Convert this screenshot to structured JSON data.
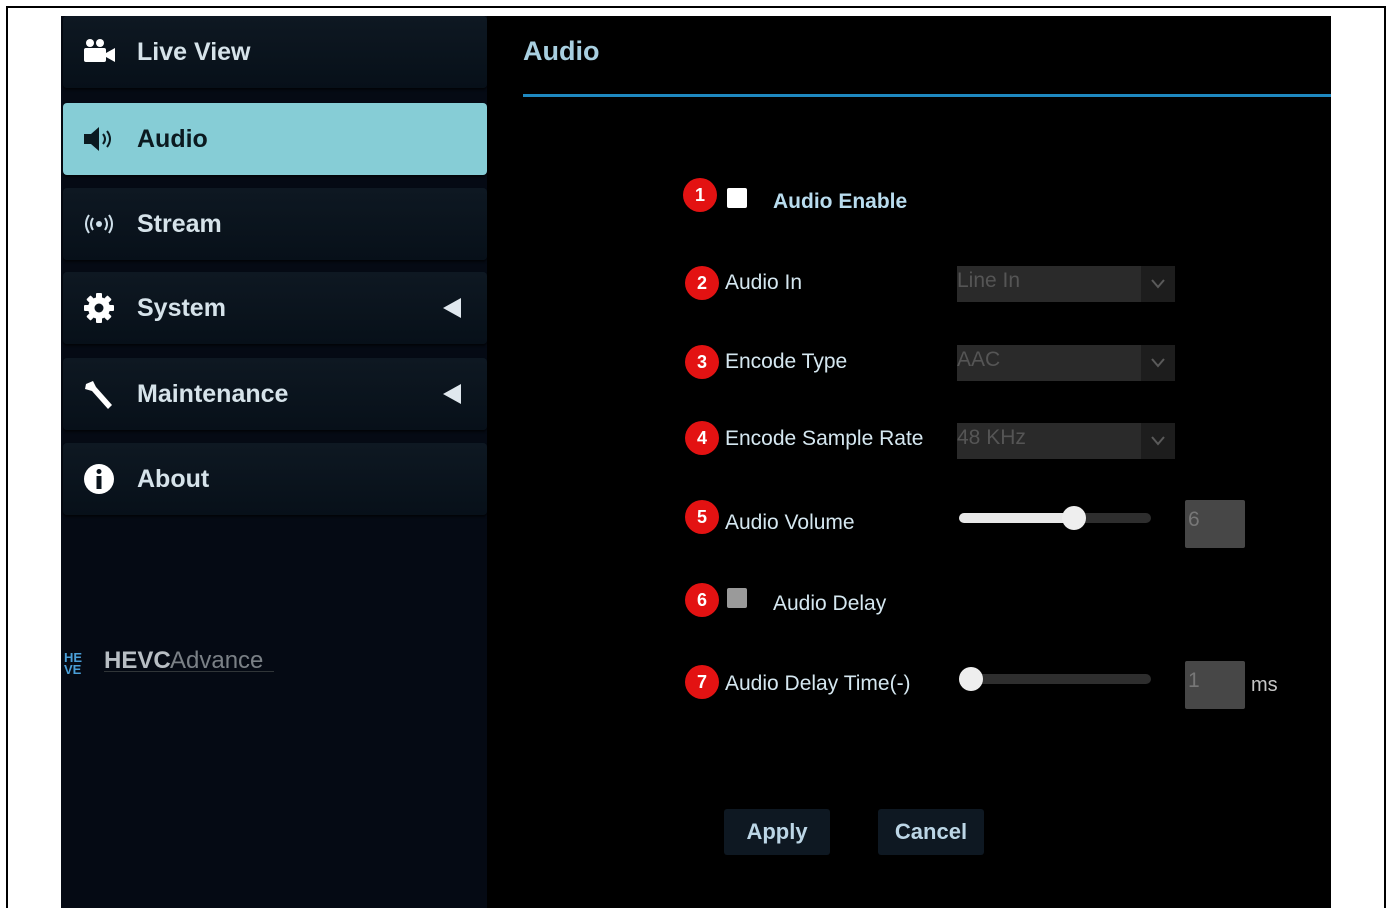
{
  "sidebar": {
    "items": [
      {
        "label": "Live View",
        "icon": "video-camera-icon"
      },
      {
        "label": "Audio",
        "icon": "speaker-icon",
        "active": true
      },
      {
        "label": "Stream",
        "icon": "broadcast-icon"
      },
      {
        "label": "System",
        "icon": "gear-icon"
      },
      {
        "label": "Maintenance",
        "icon": "wrench-icon"
      },
      {
        "label": "About",
        "icon": "info-icon"
      }
    ],
    "logo_text": "HEVCAdvance",
    "logo_mark": "HE VE"
  },
  "main": {
    "title": "Audio",
    "audio_enable": {
      "badge": "1",
      "label": "Audio Enable",
      "checked": false
    },
    "audio_in": {
      "badge": "2",
      "label": "Audio In",
      "value": "Line In"
    },
    "encode_type": {
      "badge": "3",
      "label": "Encode Type",
      "value": "AAC"
    },
    "encode_sample_rate": {
      "badge": "4",
      "label": "Encode Sample Rate",
      "value": "48 KHz"
    },
    "audio_volume": {
      "badge": "5",
      "label": "Audio Volume",
      "value": "6",
      "level_fraction": 0.6
    },
    "audio_delay": {
      "badge": "6",
      "label": "Audio Delay",
      "checked": false,
      "disabled": true
    },
    "audio_delay_time": {
      "badge": "7",
      "label": "Audio Delay Time(-)",
      "value": "1",
      "unit": "ms",
      "level_fraction": 0.0
    },
    "apply_label": "Apply",
    "cancel_label": "Cancel"
  },
  "colors": {
    "accent": "#1e88c0",
    "active_nav": "#86cdd6",
    "badge": "#e31212"
  }
}
